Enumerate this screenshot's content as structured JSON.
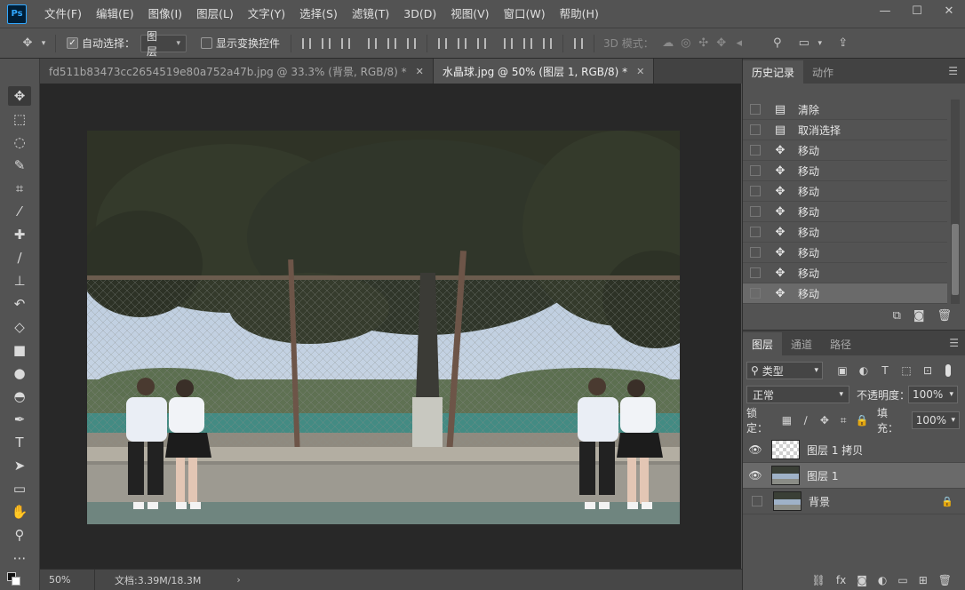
{
  "app": {
    "logo": "Ps"
  },
  "menu": [
    "文件(F)",
    "编辑(E)",
    "图像(I)",
    "图层(L)",
    "文字(Y)",
    "选择(S)",
    "滤镜(T)",
    "3D(D)",
    "视图(V)",
    "窗口(W)",
    "帮助(H)"
  ],
  "window_controls": {
    "minimize": "—",
    "maximize": "☐",
    "close": "✕"
  },
  "options": {
    "auto_select_label": "自动选择：",
    "auto_select_checked": true,
    "auto_select_value": "图层",
    "show_transform_label": "显示变换控件",
    "show_transform_checked": false,
    "mode3d_label": "3D 模式："
  },
  "tabs": [
    {
      "label": "fd511b83473cc2654519e80a752a47b.jpg @ 33.3% (背景, RGB/8) *",
      "active": false
    },
    {
      "label": "水晶球.jpg @ 50% (图层 1, RGB/8) *",
      "active": true
    }
  ],
  "status": {
    "zoom": "50%",
    "doc": "文档:3.39M/18.3M",
    "chevron": "›"
  },
  "history_panel": {
    "tabs": [
      "历史记录",
      "动作"
    ],
    "items": [
      {
        "label": "清除",
        "icon": "document-icon"
      },
      {
        "label": "取消选择",
        "icon": "document-icon"
      },
      {
        "label": "移动",
        "icon": "move-icon"
      },
      {
        "label": "移动",
        "icon": "move-icon"
      },
      {
        "label": "移动",
        "icon": "move-icon"
      },
      {
        "label": "移动",
        "icon": "move-icon"
      },
      {
        "label": "移动",
        "icon": "move-icon"
      },
      {
        "label": "移动",
        "icon": "move-icon"
      },
      {
        "label": "移动",
        "icon": "move-icon"
      },
      {
        "label": "移动",
        "icon": "move-icon"
      }
    ]
  },
  "layers_panel": {
    "tabs": [
      "图层",
      "通道",
      "路径"
    ],
    "filter_label": "类型",
    "blend_mode": "正常",
    "opacity_label": "不透明度：",
    "opacity_value": "100%",
    "lock_label": "锁定：",
    "fill_label": "填充：",
    "fill_value": "100%",
    "layers": [
      {
        "name": "图层 1 拷贝",
        "visible": true,
        "selected": false,
        "thumb": "checker",
        "locked": false
      },
      {
        "name": "图层 1",
        "visible": true,
        "selected": true,
        "thumb": "photo",
        "locked": false
      },
      {
        "name": "背景",
        "visible": false,
        "selected": false,
        "thumb": "photo",
        "locked": true
      }
    ]
  },
  "colors": {
    "ui_bg": "#535353",
    "canvas_bg": "#282828",
    "panel_tab_bg": "#424242",
    "selected_row": "#6a6a6a"
  }
}
